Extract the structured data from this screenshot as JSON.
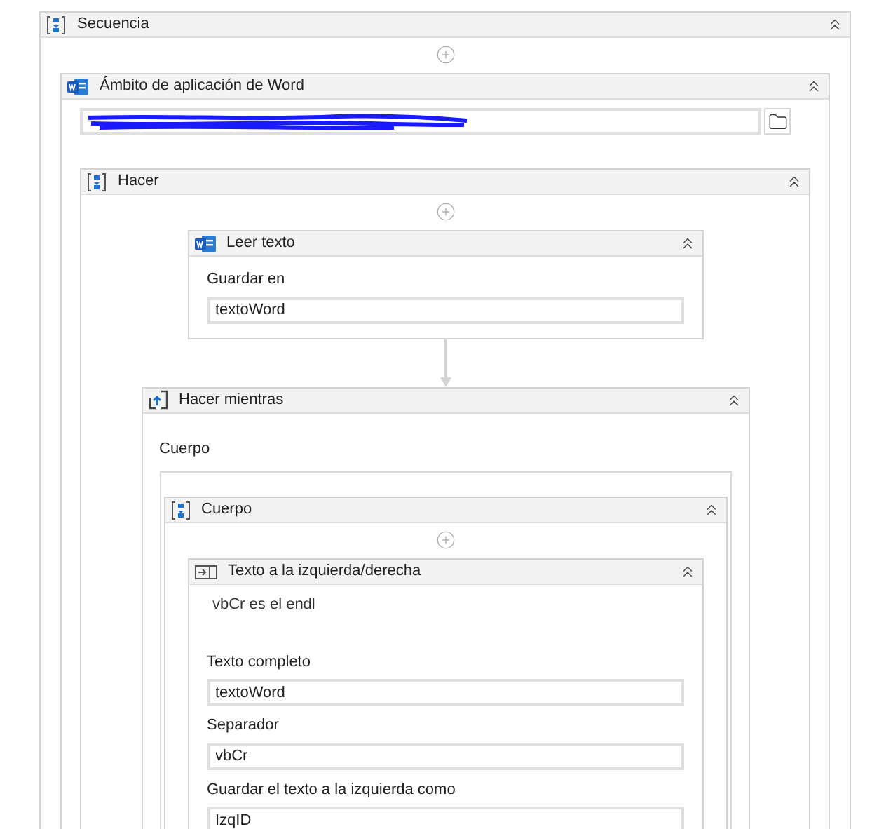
{
  "activity": {
    "kind": "sequence",
    "title": "Secuencia",
    "expanded": true,
    "children": [
      {
        "kind": "word_scope",
        "title": "Ámbito de aplicación de Word",
        "expanded": true,
        "body": {
          "kind": "sequence",
          "title": "Hacer",
          "expanded": true,
          "children": [
            {
              "kind": "read_text",
              "title": "Leer texto",
              "expanded": true,
              "fields": [
                {
                  "label": "Guardar en",
                  "value": "textoWord"
                }
              ]
            },
            {
              "kind": "do_while",
              "title": "Hacer mientras",
              "expanded": true,
              "body_label": "Cuerpo",
              "body": {
                "kind": "sequence",
                "title": "Cuerpo",
                "expanded": true,
                "children": [
                  {
                    "kind": "split_text",
                    "title": "Texto a la izquierda/derecha",
                    "expanded": true,
                    "annotation": "vbCr es el endl",
                    "fields": [
                      {
                        "label": "Texto completo",
                        "value": "textoWord"
                      },
                      {
                        "label": "Separador",
                        "value": "vbCr"
                      },
                      {
                        "label": "Guardar el texto a la izquierda como",
                        "value": "IzqID"
                      }
                    ]
                  }
                ]
              }
            }
          ]
        }
      }
    ]
  }
}
